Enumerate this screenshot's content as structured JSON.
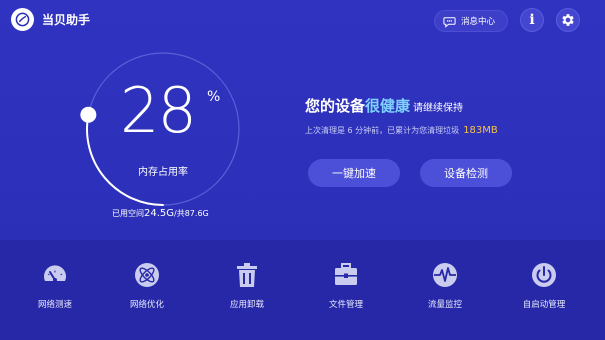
{
  "header": {
    "app_title": "当贝助手",
    "message_center": "消息中心",
    "info_glyph": "i"
  },
  "gauge": {
    "percent": "28",
    "percent_sign": "%",
    "label": "内存占用率",
    "level_fraction": 0.28
  },
  "storage": {
    "prefix": "已用空间",
    "used": "24.5G",
    "sep": "/共",
    "total": "87.6G"
  },
  "status": {
    "part1": "您的设备",
    "part2": "很健康",
    "part3": "请继续保持"
  },
  "cleanup": {
    "text": "上次清理是 6 分钟前，已累计为您清理垃圾",
    "amount": "183MB"
  },
  "actions": {
    "speedup": "一键加速",
    "detect": "设备检测"
  },
  "tools": [
    {
      "label": "网络测速",
      "icon": "speedometer-icon"
    },
    {
      "label": "网络优化",
      "icon": "atom-icon"
    },
    {
      "label": "应用卸载",
      "icon": "trash-icon"
    },
    {
      "label": "文件管理",
      "icon": "briefcase-icon"
    },
    {
      "label": "流量监控",
      "icon": "pulse-icon"
    },
    {
      "label": "自启动管理",
      "icon": "power-icon"
    }
  ],
  "colors": {
    "background": "#2c2fb6",
    "bottom_bar": "#2728a7",
    "accent_blue": "#7fd2ff",
    "accent_amount": "#f4c24a",
    "button": "#4c4fd7"
  }
}
